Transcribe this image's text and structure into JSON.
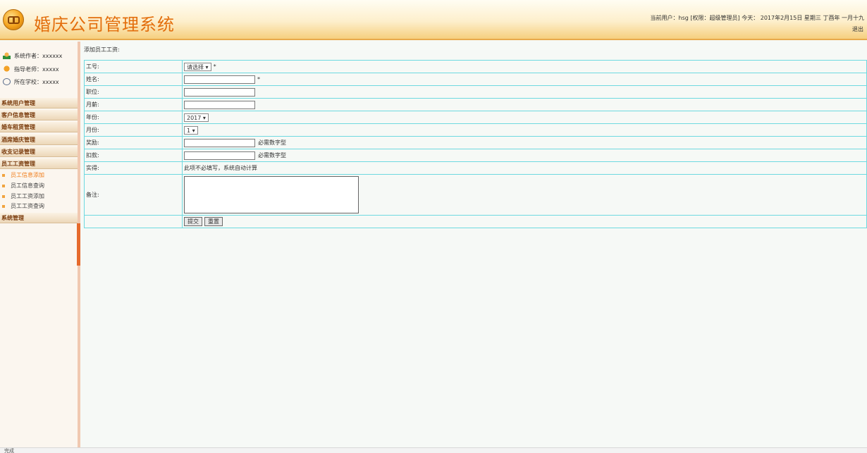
{
  "header": {
    "app_title": "婚庆公司管理系统",
    "user_info": "当前用户：hsg [权限：超级管理员] 今天： 2017年2月15日 星期三 丁酉年 一月十九",
    "logout": "退出",
    "accent_color": "#e36e0c"
  },
  "sidebar": {
    "info": [
      {
        "label": "系统作者：xxxxxx",
        "icon": "people-icon"
      },
      {
        "label": "指导老师：xxxxx",
        "icon": "teacher-icon"
      },
      {
        "label": "所在学校：xxxxx",
        "icon": "school-icon"
      }
    ],
    "menu": [
      {
        "label": "系统用户管理"
      },
      {
        "label": "客户信息管理"
      },
      {
        "label": "婚车租赁管理"
      },
      {
        "label": "酒席婚庆管理"
      },
      {
        "label": "收支记录管理"
      },
      {
        "label": "员工工资管理"
      }
    ],
    "submenu": [
      {
        "label": "员工信息添加",
        "active": true
      },
      {
        "label": "员工信息查询"
      },
      {
        "label": "员工工资添加"
      },
      {
        "label": "员工工资查询"
      }
    ],
    "system_menu": "系统管理"
  },
  "form": {
    "title": "添加员工工资:",
    "rows": {
      "emp_no": {
        "label": "工号:",
        "select": "请选择",
        "required": "*"
      },
      "name": {
        "label": "姓名:",
        "value": "",
        "required": "*"
      },
      "position": {
        "label": "职位:",
        "value": ""
      },
      "salary": {
        "label": "月薪:",
        "value": ""
      },
      "year": {
        "label": "年份:",
        "select": "2017"
      },
      "month": {
        "label": "月份:",
        "select": "1"
      },
      "bonus": {
        "label": "奖励:",
        "value": "",
        "hint": "必需数字型"
      },
      "deduction": {
        "label": "扣款:",
        "value": "",
        "hint": "必需数字型"
      },
      "actual": {
        "label": "实得:",
        "text": "此项不必填写，系统自动计算"
      },
      "remark": {
        "label": "备注:",
        "value": ""
      }
    },
    "buttons": {
      "submit": "提交",
      "reset": "重置"
    }
  },
  "statusbar": {
    "left": "完成"
  }
}
